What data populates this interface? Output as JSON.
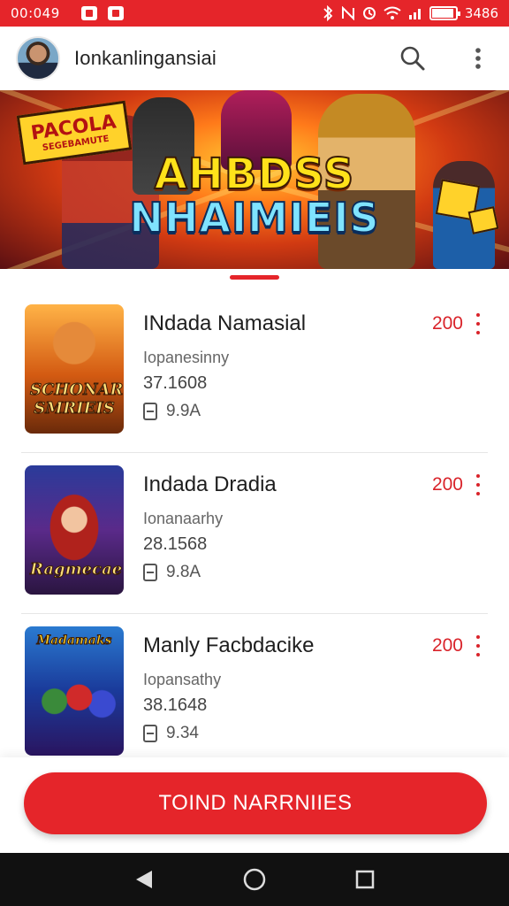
{
  "status_bar": {
    "time": "00:049",
    "battery_text": "3486",
    "icons": [
      "notification-icon",
      "notification-icon",
      "bluetooth-icon",
      "nfc-icon",
      "wifi-icon",
      "signal-icon",
      "battery-icon"
    ]
  },
  "app_bar": {
    "title": "Ionkanlingansiai",
    "actions": [
      "search-icon",
      "more-vert-icon"
    ]
  },
  "banner": {
    "title_line1": "AHBDSS",
    "title_line2": "NHAIMIEIS",
    "sign_line1": "PACOLA",
    "sign_line2": "SEGEBAMUTE"
  },
  "games": [
    {
      "title": "INdada Namasial",
      "subtitle": "Iopanesinny",
      "count": "37.1608",
      "size": "9.9A",
      "price": "200",
      "thumb_caption": "SCHONAR SMRIEIS"
    },
    {
      "title": "Indada Dradia",
      "subtitle": "Ionanaarhy",
      "count": "28.1568",
      "size": "9.8A",
      "price": "200",
      "thumb_caption": "Ragmecae"
    },
    {
      "title": "Manly Facbdacike",
      "subtitle": "Iopansathy",
      "count": "38.1648",
      "size": "9.34",
      "price": "200",
      "thumb_caption": "Madamaks"
    }
  ],
  "cta": {
    "label": "TOIND NARRNIIES"
  },
  "colors": {
    "accent": "#e5252a",
    "price": "#d9232a",
    "nav_bar": "#111111"
  },
  "nav": [
    "back-icon",
    "home-icon",
    "recents-icon"
  ]
}
